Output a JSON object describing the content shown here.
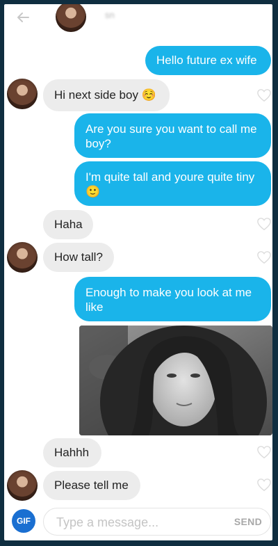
{
  "header": {
    "back_icon": "back-arrow-icon",
    "name": "sn"
  },
  "messages": [
    {
      "side": "out",
      "text": "Hello future ex wife"
    },
    {
      "side": "in",
      "text": "Hi next side boy ☺️"
    },
    {
      "side": "out",
      "text": "Are you sure you want to call me boy?"
    },
    {
      "side": "out",
      "text": "I'm quite tall and youre quite tiny 🙂"
    },
    {
      "side": "in",
      "text": "Haha"
    },
    {
      "side": "in",
      "text": "How tall?"
    },
    {
      "side": "out",
      "text": "Enough to make you look at me like"
    },
    {
      "side": "out",
      "type": "image"
    },
    {
      "side": "in",
      "text": "Hahhh"
    },
    {
      "side": "in",
      "text": "Please tell me"
    }
  ],
  "composer": {
    "gif_label": "GIF",
    "placeholder": "Type a message...",
    "send_label": "SEND"
  },
  "colors": {
    "outgoing": "#1ab4ea",
    "incoming": "#ececec",
    "gif": "#1a6fd1"
  }
}
